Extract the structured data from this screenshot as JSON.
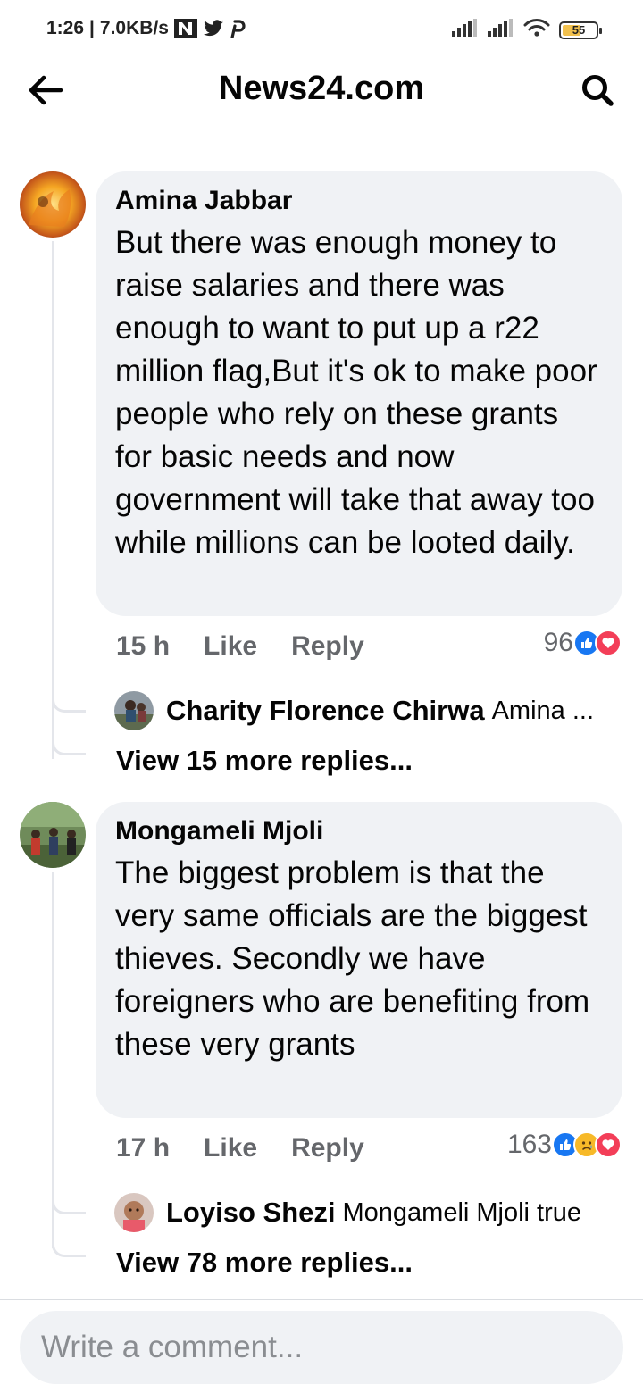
{
  "status_bar": {
    "time": "1:26",
    "speed": "7.0KB/s",
    "battery": "55",
    "battery_level": 0.55
  },
  "header": {
    "title": "News24.com"
  },
  "comments": [
    {
      "author": "Amina Jabbar",
      "text": "But there was enough money to raise salaries and there was enough to want to put up a r22 million flag,But it's ok to make poor people who rely on these grants for basic needs and now government will take that away too while millions can be looted daily.",
      "time": "15 h",
      "like_label": "Like",
      "reply_label": "Reply",
      "reaction_count": "96",
      "reactions": [
        "like-icon",
        "love-icon"
      ],
      "reply_preview": {
        "author": "Charity Florence Chirwa",
        "snippet": "Amina ..."
      },
      "view_more": "View 15 more replies..."
    },
    {
      "author": "Mongameli Mjoli",
      "text": "The biggest problem is that the very same officials are the biggest thieves. Secondly we have foreigners who are benefiting from these very grants",
      "time": "17 h",
      "like_label": "Like",
      "reply_label": "Reply",
      "reaction_count": "163",
      "reactions": [
        "like-icon",
        "sad-icon",
        "love-icon"
      ],
      "reply_preview": {
        "author": "Loyiso Shezi",
        "snippet": "Mongameli Mjoli true"
      },
      "view_more": "View 78 more replies..."
    }
  ],
  "composer": {
    "placeholder": "Write a comment..."
  },
  "colors": {
    "bubble": "#f0f2f5",
    "like_blue": "#1877f2",
    "love_red": "#f33e58",
    "sad_yellow": "#f7b928",
    "muted_text": "#65676b"
  }
}
